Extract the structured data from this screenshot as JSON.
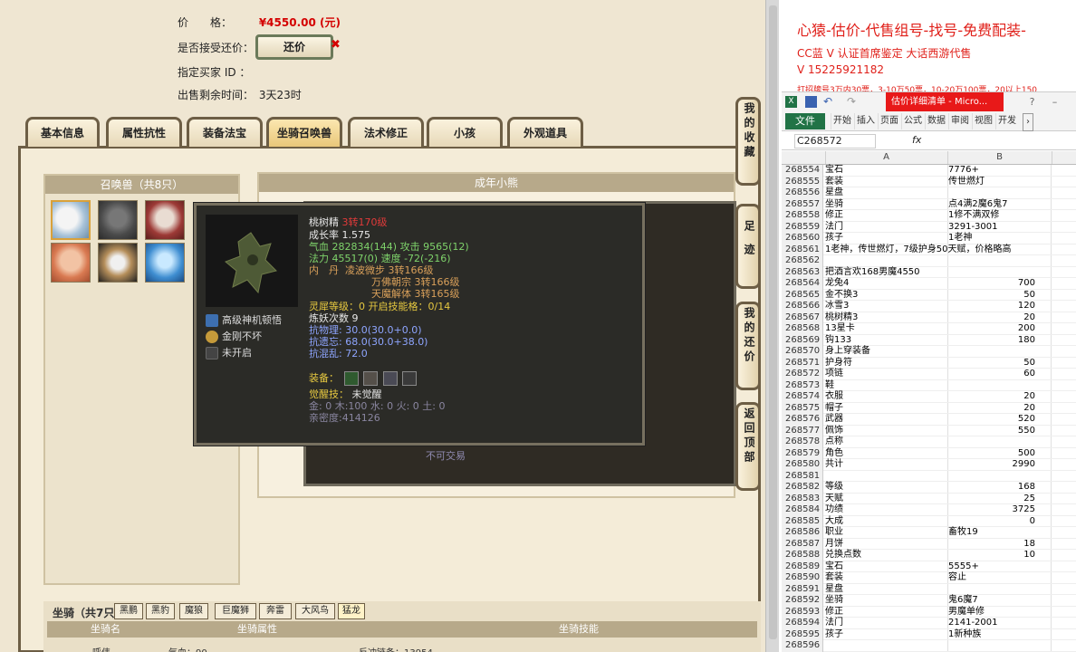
{
  "listing": {
    "price_label": "价　　格：",
    "price_value": "¥4550.00 (元)",
    "counter_label": "是否接受还价：",
    "counter_button": "还价",
    "buyer_label": "指定买家 ID ：",
    "remaining_label": "出售剩余时间：",
    "remaining_value": "3天23时"
  },
  "tabs": [
    "基本信息",
    "属性抗性",
    "装备法宝",
    "坐骑召唤兽",
    "法术修正",
    "小孩",
    "外观道具"
  ],
  "active_tab": "坐骑召唤兽",
  "pet_panel": {
    "title": "召唤兽（共8只）"
  },
  "pet_detail": {
    "title": "成年小熊"
  },
  "no_trade": "不可交易",
  "tooltip": {
    "name": "桃树精",
    "level": "3转170级",
    "growth": "成长率 1.575",
    "hp_label": "气血",
    "hp": "282834(144)",
    "atk_label": "攻击",
    "atk": "9565(12)",
    "mp_label": "法力",
    "mp": "45517(0)",
    "spd_label": "速度",
    "spd": "-72(-216)",
    "dan_label": "内　丹",
    "dan1": "凌波微步 3转166级",
    "dan2": "万佛朝宗 3转166级",
    "dan3": "天魔解体 3转165级",
    "lingxi": "灵犀等级：0 开启技能格：0/14",
    "lianyao": "炼妖次数 9",
    "res1": "抗物理: 30.0(30.0+0.0)",
    "res2": "抗遗忘: 68.0(30.0+38.0)",
    "res3": "抗混乱: 72.0",
    "equip_label": "装备：",
    "awaken_label": "觉醒技：",
    "awaken_value": "未觉醒",
    "elements": "金: 0 木:100 水: 0 火: 0 土: 0",
    "intimacy": "亲密度:414126",
    "skills": [
      {
        "label": "高级神机顿悟",
        "icon": "pet-skill-icon"
      },
      {
        "label": "金刚不坏",
        "icon": "pet-skill-icon"
      },
      {
        "label": "未开启",
        "icon": "locked-skill-icon"
      }
    ]
  },
  "side_buttons": [
    "我的收藏",
    "足迹",
    "我的还价",
    "返回顶部"
  ],
  "mounts": {
    "title": "坐骑（共7只）",
    "tabs": [
      "黑鹏",
      "黑豹",
      "魔狼",
      "巨魔狮",
      "奔雷",
      "大风鸟",
      "猛龙"
    ],
    "active": "猛龙",
    "headers": [
      "坐骑名",
      "坐骑属性",
      "坐骑技能"
    ],
    "row_cells": [
      "呼伟",
      "气血：90",
      "反冲链条：13954"
    ]
  },
  "promo": {
    "line1": "心猿-估价-代售组号-找号-免费配装-",
    "line2": "CC蓝 V 认证首席鉴定 大话西游代售",
    "line3": "V 15225921182",
    "line4": "打招牌号3万内30票，3-10万50票，10-20万100票，20以上150"
  },
  "excel": {
    "window_title": "估价详细清单 - Micro...",
    "file_tab": "文件",
    "ribbon_tabs": [
      "开始",
      "插入",
      "页面",
      "公式",
      "数据",
      "审阅",
      "视图",
      "开发"
    ],
    "name_box": "C268572",
    "fx": "fx",
    "col_a": "A",
    "col_b": "B",
    "rows": [
      [
        "268554",
        "宝石",
        "7776+",
        false
      ],
      [
        "268555",
        "套装",
        "传世燃灯",
        false
      ],
      [
        "268556",
        "星盘",
        "",
        false
      ],
      [
        "268557",
        "坐骑",
        "点4满2魔6鬼7",
        false
      ],
      [
        "268558",
        "修正",
        "1修不满双修",
        false
      ],
      [
        "268559",
        "法门",
        "3291-3001",
        false
      ],
      [
        "268560",
        "孩子",
        "1老神",
        false
      ],
      [
        "268561",
        "1老神，传世燃灯，7级护身50天赋，价格略高",
        "",
        false
      ],
      [
        "268562",
        "",
        "",
        false
      ],
      [
        "268563",
        "把酒言欢168男魔4550",
        "",
        false
      ],
      [
        "268564",
        "龙兔4",
        "700",
        true
      ],
      [
        "268565",
        "金不换3",
        "50",
        true
      ],
      [
        "268566",
        "冰雪3",
        "120",
        true
      ],
      [
        "268567",
        "桃树精3",
        "20",
        true
      ],
      [
        "268568",
        "13星卡",
        "200",
        true
      ],
      [
        "268569",
        "钩133",
        "180",
        true
      ],
      [
        "268570",
        "身上穿装备",
        "",
        false
      ],
      [
        "268571",
        "护身符",
        "50",
        true
      ],
      [
        "268572",
        "项链",
        "60",
        true
      ],
      [
        "268573",
        "鞋",
        "",
        false
      ],
      [
        "268574",
        "衣服",
        "20",
        true
      ],
      [
        "268575",
        "帽子",
        "20",
        true
      ],
      [
        "268576",
        "武器",
        "520",
        true
      ],
      [
        "268577",
        "佩饰",
        "550",
        true
      ],
      [
        "268578",
        "点称",
        "",
        false
      ],
      [
        "268579",
        "角色",
        "500",
        true
      ],
      [
        "268580",
        "共计",
        "2990",
        true
      ],
      [
        "268581",
        "",
        "",
        false
      ],
      [
        "268582",
        "等级",
        "168",
        true
      ],
      [
        "268583",
        "天赋",
        "25",
        true
      ],
      [
        "268584",
        "功绩",
        "3725",
        true
      ],
      [
        "268585",
        "大成",
        "0",
        true
      ],
      [
        "268586",
        "职业",
        "畜牧19",
        false
      ],
      [
        "268587",
        "月饼",
        "18",
        true
      ],
      [
        "268588",
        "兑换点数",
        "10",
        true
      ],
      [
        "268589",
        "宝石",
        "5555+",
        false
      ],
      [
        "268590",
        "套装",
        "容止",
        false
      ],
      [
        "268591",
        "星盘",
        "",
        false
      ],
      [
        "268592",
        "坐骑",
        "鬼6魔7",
        false
      ],
      [
        "268593",
        "修正",
        "男魔单修",
        false
      ],
      [
        "268594",
        "法门",
        "2141-2001",
        false
      ],
      [
        "268595",
        "孩子",
        "1新种族",
        false
      ],
      [
        "268596",
        "",
        "",
        false
      ]
    ]
  },
  "colors": {
    "accent_red": "#e0201a",
    "excel_green": "#217346",
    "tab_border": "#6d5e45"
  }
}
